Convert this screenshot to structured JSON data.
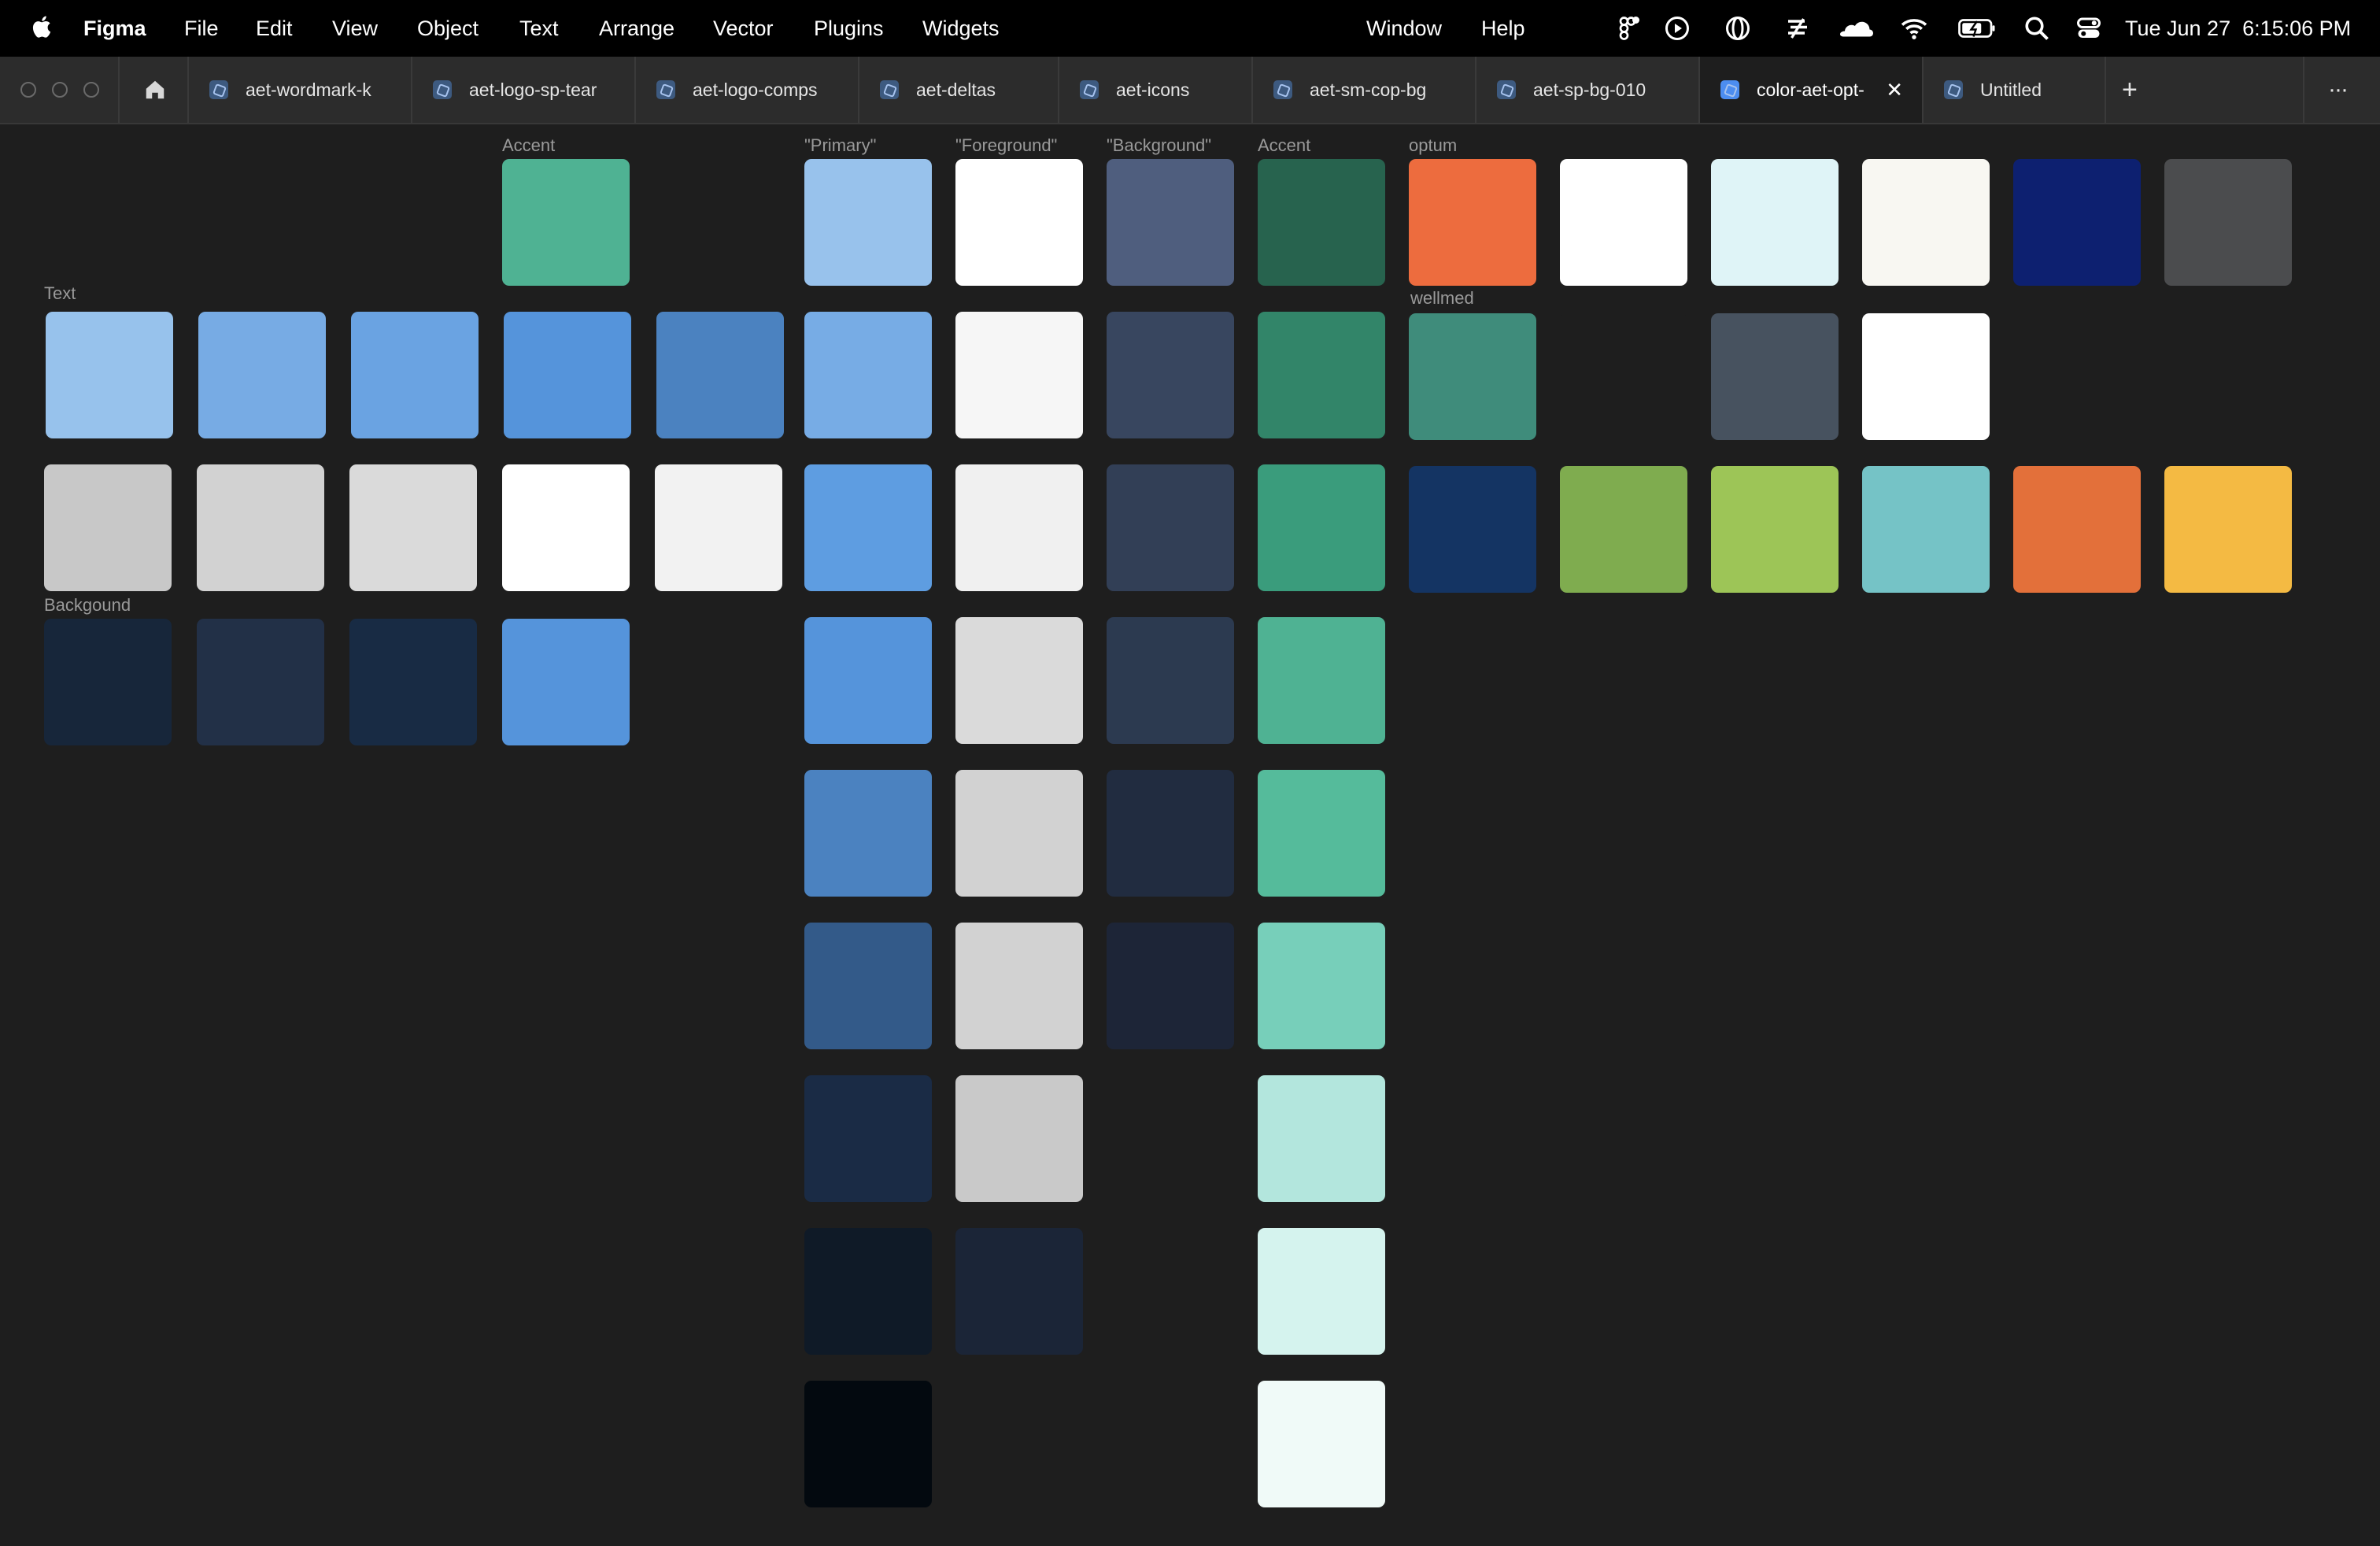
{
  "menubar": {
    "app_name": "Figma",
    "menus": [
      "File",
      "Edit",
      "View",
      "Object",
      "Text",
      "Arrange",
      "Vector",
      "Plugins",
      "Widgets"
    ],
    "right_menus": [
      "Window",
      "Help"
    ],
    "clock": "Tue Jun 27  6:15:06 PM",
    "status_icons": [
      "figma-menu-icon",
      "play-circle-icon",
      "globe-icon",
      "stack-icon",
      "cloud-icon",
      "wifi-icon",
      "battery-icon",
      "search-icon",
      "control-center-icon"
    ]
  },
  "tabs": {
    "items": [
      {
        "label": "aet-wordmark-k"
      },
      {
        "label": "aet-logo-sp-tear"
      },
      {
        "label": "aet-logo-comps"
      },
      {
        "label": "aet-deltas"
      },
      {
        "label": "aet-icons"
      },
      {
        "label": "aet-sm-cop-bg"
      },
      {
        "label": "aet-sp-bg-010"
      },
      {
        "label": "color-aet-opt-",
        "active": true
      },
      {
        "label": "Untitled"
      }
    ],
    "close_glyph": "✕",
    "new_tab_glyph": "+",
    "more_glyph": "···"
  },
  "canvas": {
    "labels": {
      "accent_left": "Accent",
      "text": "Text",
      "background": "Backgound",
      "primary": "\"Primary\"",
      "foreground": "\"Foreground\"",
      "background_q": "\"Background\"",
      "accent": "Accent",
      "optum": "optum",
      "wellmed": "wellmed"
    },
    "swatches": {
      "accent_left": [
        "#4fb293"
      ],
      "text": [
        "#97c2ec",
        "#77abe4",
        "#6aa3e2",
        "#5594db",
        "#4b82c0"
      ],
      "neutral": [
        "#c8c8c8",
        "#d2d2d2",
        "#dadada",
        "#ffffff",
        "#f2f2f2"
      ],
      "background": [
        "#17263a",
        "#223047",
        "#182b44",
        "#5594db"
      ],
      "primary": [
        "#98c2ec",
        "#77ace5",
        "#5e9de1",
        "#5594db",
        "#4b82c0",
        "#335a89",
        "#1a2b45",
        "#0f1a27",
        "#03090f"
      ],
      "foreground": [
        "#ffffff",
        "#f6f6f6",
        "#f0f0f0",
        "#dadada",
        "#d2d2d2",
        "#d2d2d2",
        "#c9c9c9",
        "#1b2537"
      ],
      "background_cols": [
        "#4f5e7e",
        "#38465f",
        "#323f56",
        "#2c3a50",
        "#212c40",
        "#1d2537"
      ],
      "accent": [
        "#27634e",
        "#328569",
        "#3a9c7c",
        "#4fb293",
        "#55bb9b",
        "#77cfba",
        "#b3e6dd",
        "#d5f3ee",
        "#f0faf8"
      ],
      "optum_row": [
        "#ed6c3e",
        "#ffffff",
        "#dff4f7",
        "#f8f7f2",
        "#0d2070",
        "#4b4c4e"
      ],
      "wellmed_row": [
        "#3f8c7b",
        "#1e1e1e",
        "#47525f",
        "#ffffff"
      ],
      "bottom_row": [
        "#143463",
        "#7fac4f",
        "#9dc557",
        "#75c3c6",
        "#e3703a",
        "#f4ba43"
      ]
    }
  }
}
